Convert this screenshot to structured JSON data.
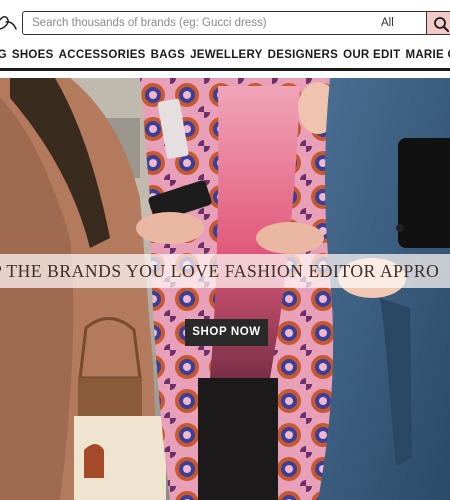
{
  "header": {
    "logo_name": "brand-logo",
    "search": {
      "placeholder": "Search thousands of brands (eg: Gucci dress)",
      "value": "",
      "scope": "All"
    }
  },
  "nav": {
    "items": [
      {
        "label": "NG"
      },
      {
        "label": "SHOES"
      },
      {
        "label": "ACCESSORIES"
      },
      {
        "label": "BAGS"
      },
      {
        "label": "JEWELLERY"
      },
      {
        "label": "DESIGNERS"
      },
      {
        "label": "OUR EDIT"
      },
      {
        "label": "MARIE CLA"
      }
    ]
  },
  "hero": {
    "tagline": "P THE BRANDS YOU LOVE FASHION EDITOR APPRO",
    "cta_label": "SHOP NOW"
  },
  "colors": {
    "search_button_bg": "#f4c9c9",
    "nav_underline": "#1a1a1a",
    "cta_bg": "#2a2a2a"
  }
}
